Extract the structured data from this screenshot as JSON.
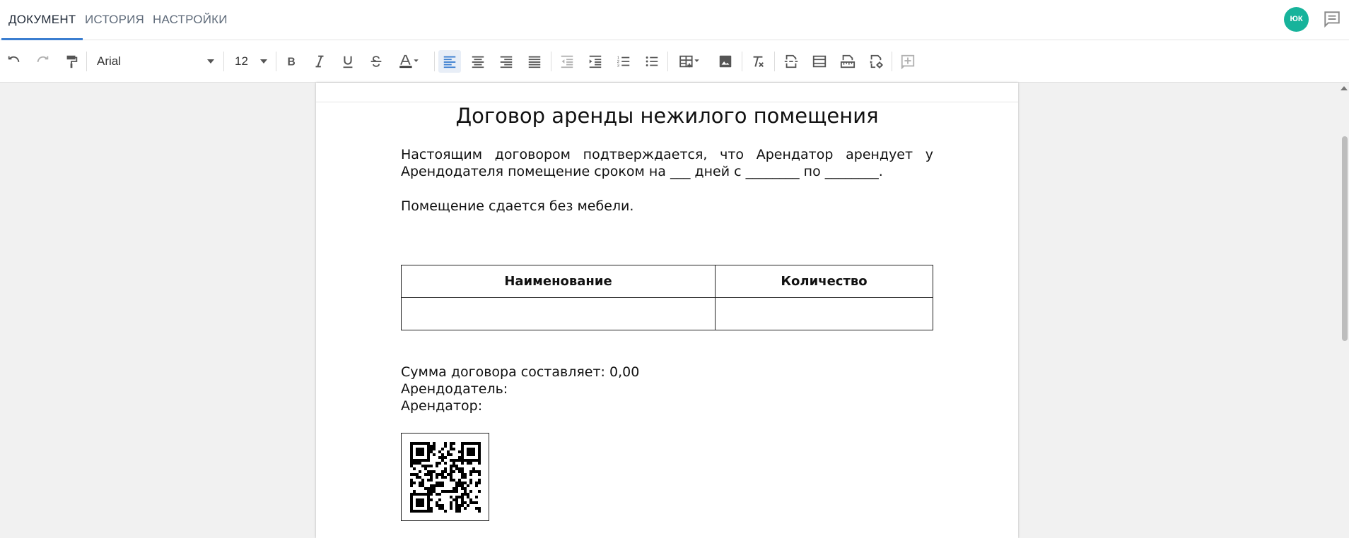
{
  "tabs": [
    {
      "label": "ДОКУМЕНТ",
      "active": true
    },
    {
      "label": "ИСТОРИЯ",
      "active": false
    },
    {
      "label": "НАСТРОЙКИ",
      "active": false
    }
  ],
  "user": {
    "initials": "ЮК",
    "avatar_color": "#17b39b"
  },
  "accent_color": "#3b7ed0",
  "toolbar": {
    "font_family": "Arial",
    "font_size": "12",
    "alignment_active": "left",
    "icons": [
      "undo-icon",
      "redo-icon",
      "format-paint-icon",
      "bold-icon",
      "italic-icon",
      "underline-icon",
      "strikethrough-icon",
      "text-color-icon",
      "align-left-icon",
      "align-center-icon",
      "align-right-icon",
      "align-justify-icon",
      "outdent-icon",
      "indent-icon",
      "numbered-list-icon",
      "bulleted-list-icon",
      "table-icon",
      "image-icon",
      "clear-formatting-icon",
      "page-break-icon",
      "header-footer-icon",
      "ruler-icon",
      "field-settings-icon",
      "add-box-icon"
    ]
  },
  "document": {
    "title": "Договор аренды нежилого помещения",
    "paragraph1": "Настоящим договором подтверждается, что Арендатор арендует у Арендодателя  помещение сроком на ___ дней с ________ по ________.",
    "paragraph2": "Помещение сдается без мебели.",
    "table": {
      "headers": [
        "Наименование",
        "Количество"
      ],
      "rows": [
        [
          "",
          ""
        ]
      ]
    },
    "sum_line": "Сумма договора составляет: 0,00",
    "landlord_line": "Арендодатель:",
    "tenant_line": "Арендатор:"
  }
}
